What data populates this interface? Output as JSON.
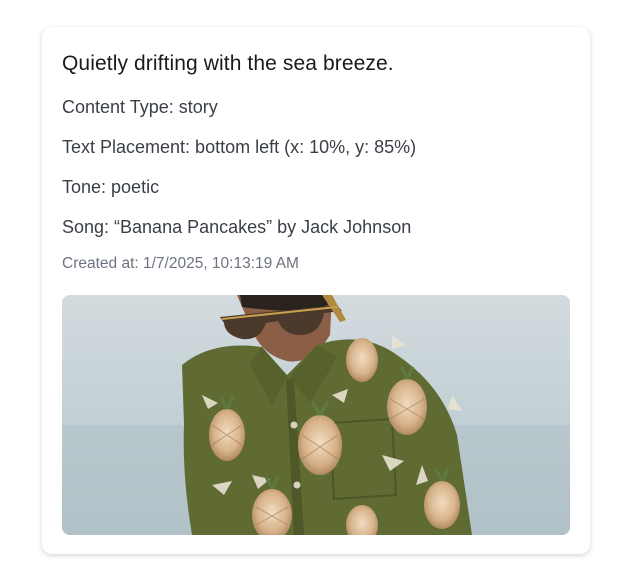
{
  "post": {
    "caption": "Quietly drifting with the sea breeze.",
    "content_type": "Content Type: story",
    "text_placement": "Text Placement: bottom left (x: 10%, y: 85%)",
    "tone": "Tone: poetic",
    "song": "Song: “Banana Pancakes” by Jack Johnson",
    "created_at": "Created at: 1/7/2025, 10:13:19 AM",
    "image": {
      "alt": "Man in a green pineapple-print shirt wearing sunglasses by the sea"
    }
  },
  "colors": {
    "card_bg": "#ffffff",
    "caption_text": "#1a1a1a",
    "meta_text": "#3a3f47",
    "timestamp_text": "#6b7280",
    "shirt_green": "#5f6b33",
    "sea_blue": "#b9c8cf"
  }
}
